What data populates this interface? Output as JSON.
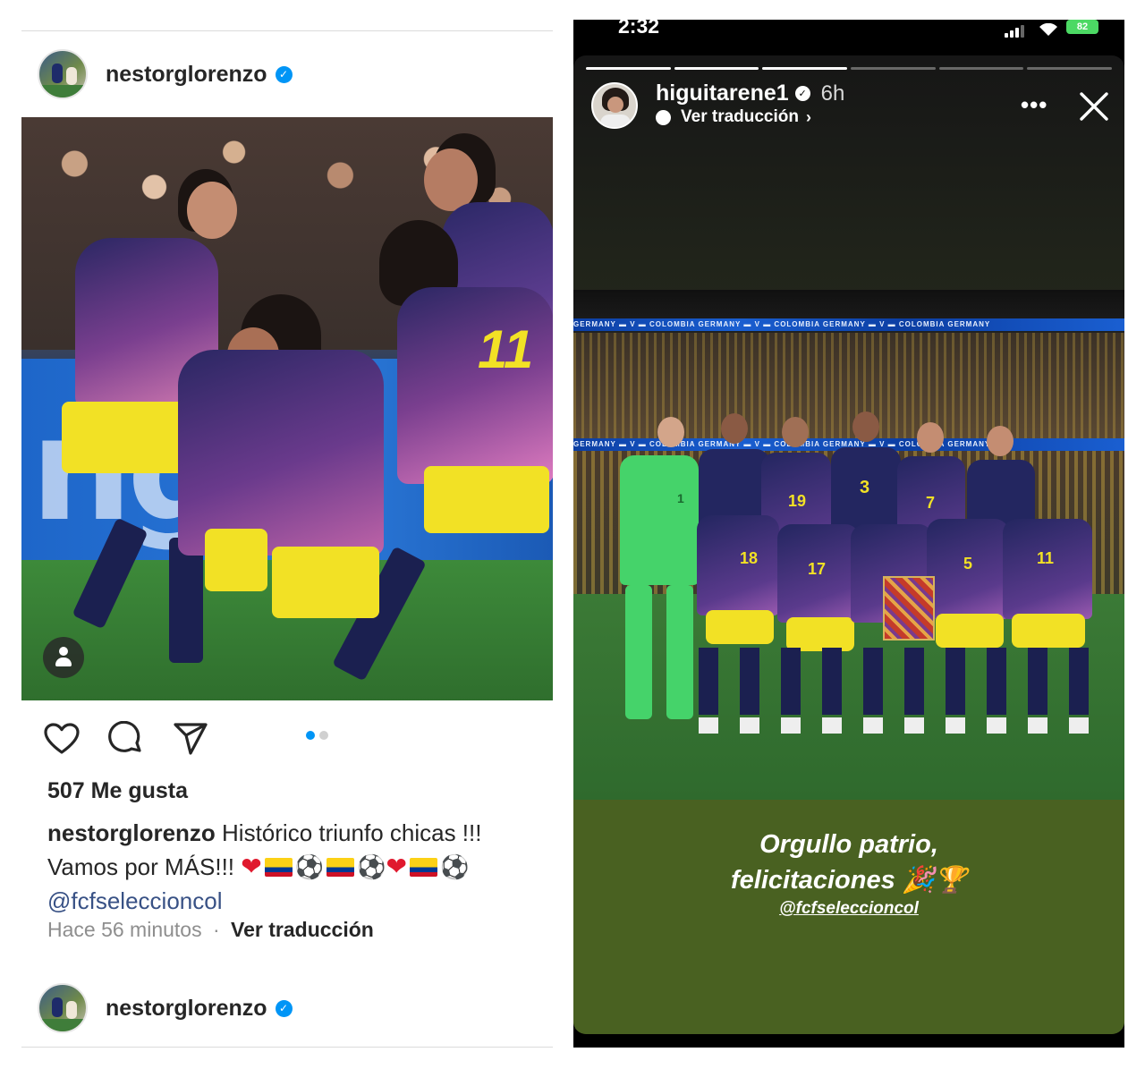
{
  "post": {
    "username": "nestorglorenzo",
    "verified_icon": "verified-badge-icon",
    "likes": "507 Me gusta",
    "caption_username": "nestorglorenzo",
    "caption_line1": "Histórico triunfo chicas !!!",
    "caption_line2": "Vamos por MÁS!!!",
    "mention": "@fcfseleccioncol",
    "time": "Hace 56 minutos",
    "separator": "·",
    "translate": "Ver traducción",
    "carousel": {
      "count": 2,
      "active": 0
    },
    "actions": [
      "heart-icon",
      "comment-icon",
      "share-icon"
    ]
  },
  "next_post": {
    "username": "nestorglorenzo"
  },
  "story": {
    "status_time": "2:32",
    "battery": "82",
    "username": "higuitarene1",
    "time": "6h",
    "translate": "Ver traducción",
    "progress": {
      "segments": 6,
      "completed": 3
    },
    "text_line1": "Orgullo patrio,",
    "text_line2": "felicitaciones 🎉🏆",
    "mention": "@fcfseleccioncol",
    "banner_text": "GERMANY ▬ V ▬ COLOMBIA    GERMANY ▬ V ▬ COLOMBIA    GERMANY ▬ V ▬ COLOMBIA    GERMANY",
    "jersey_numbers": [
      "1",
      "19",
      "3",
      "7",
      "18",
      "17",
      "5",
      "11"
    ]
  },
  "colors": {
    "ig_blue": "#0095f6",
    "story_green": "#496121",
    "colombia_yellow": "#f2e125",
    "colombia_navy": "#1b2050"
  }
}
